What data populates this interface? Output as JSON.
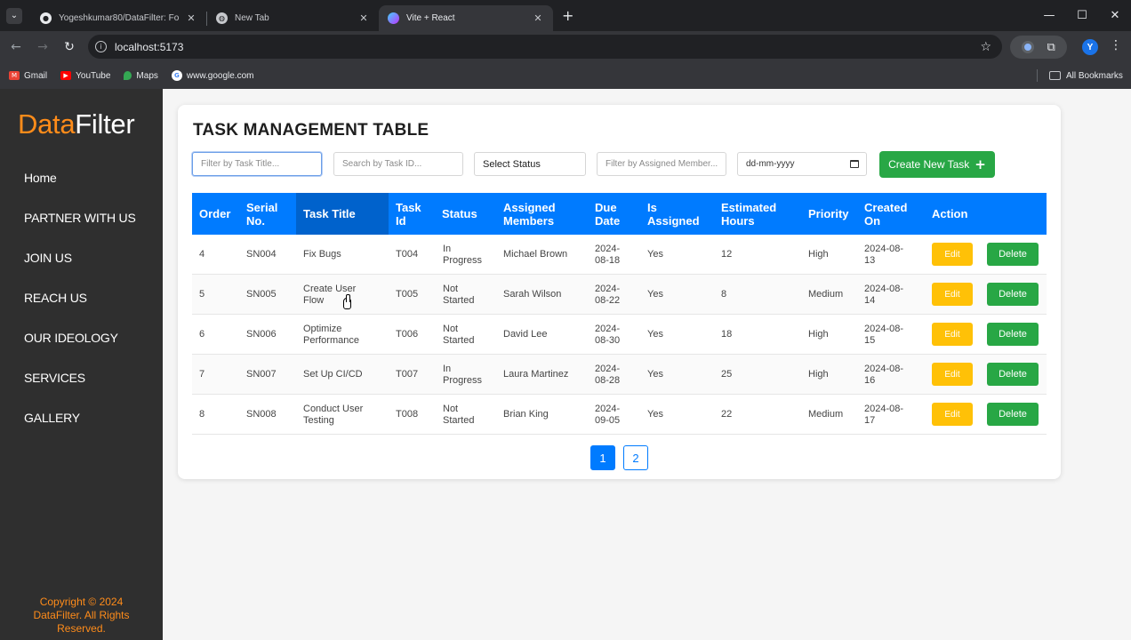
{
  "browser": {
    "tabs": [
      {
        "title": "Yogeshkumar80/DataFilter: Fo",
        "favicon": "github-icon",
        "active": false
      },
      {
        "title": "New Tab",
        "favicon": "chrome-globe-icon",
        "active": false
      },
      {
        "title": "Vite + React",
        "favicon": "vite-icon",
        "active": true
      }
    ],
    "url": "localhost:5173",
    "bookmarks": [
      "Gmail",
      "YouTube",
      "Maps",
      "www.google.com"
    ],
    "all_bookmarks": "All Bookmarks",
    "profile_initial": "Y"
  },
  "sidebar": {
    "brand_part1": "Data",
    "brand_part2": "Filter",
    "items": [
      "Home",
      "PARTNER WITH US",
      "JOIN US",
      "REACH US",
      "OUR IDEOLOGY",
      "SERVICES",
      "GALLERY"
    ],
    "copyright": "Copyright © 2024 DataFilter. All Rights Reserved."
  },
  "main": {
    "title": "TASK MANAGEMENT TABLE",
    "filters": {
      "task_title_placeholder": "Filter by Task Title...",
      "task_id_placeholder": "Search by Task ID...",
      "status_select": "Select Status",
      "member_placeholder": "Filter by Assigned Member...",
      "date_placeholder": "dd-mm-yyyy"
    },
    "create_button": "Create New Task",
    "columns": [
      {
        "key": "order",
        "label": "Order"
      },
      {
        "key": "serial",
        "label": "Serial No."
      },
      {
        "key": "title",
        "label": "Task Title"
      },
      {
        "key": "id",
        "label": "Task Id"
      },
      {
        "key": "status",
        "label": "Status"
      },
      {
        "key": "members",
        "label": "Assigned Members"
      },
      {
        "key": "due",
        "label": "Due Date"
      },
      {
        "key": "assigned",
        "label": "Is Assigned"
      },
      {
        "key": "hours",
        "label": "Estimated Hours"
      },
      {
        "key": "priority",
        "label": "Priority"
      },
      {
        "key": "created",
        "label": "Created On"
      },
      {
        "key": "action",
        "label": "Action"
      }
    ],
    "rows": [
      {
        "order": "4",
        "serial": "SN004",
        "title": "Fix Bugs",
        "id": "T004",
        "status": "In Progress",
        "members": "Michael Brown",
        "due": "2024-08-18",
        "assigned": "Yes",
        "hours": "12",
        "priority": "High",
        "created": "2024-08-13"
      },
      {
        "order": "5",
        "serial": "SN005",
        "title": "Create User Flow",
        "id": "T005",
        "status": "Not Started",
        "members": "Sarah Wilson",
        "due": "2024-08-22",
        "assigned": "Yes",
        "hours": "8",
        "priority": "Medium",
        "created": "2024-08-14"
      },
      {
        "order": "6",
        "serial": "SN006",
        "title": "Optimize Performance",
        "id": "T006",
        "status": "Not Started",
        "members": "David Lee",
        "due": "2024-08-30",
        "assigned": "Yes",
        "hours": "18",
        "priority": "High",
        "created": "2024-08-15"
      },
      {
        "order": "7",
        "serial": "SN007",
        "title": "Set Up CI/CD",
        "id": "T007",
        "status": "In Progress",
        "members": "Laura Martinez",
        "due": "2024-08-28",
        "assigned": "Yes",
        "hours": "25",
        "priority": "High",
        "created": "2024-08-16"
      },
      {
        "order": "8",
        "serial": "SN008",
        "title": "Conduct User Testing",
        "id": "T008",
        "status": "Not Started",
        "members": "Brian King",
        "due": "2024-09-05",
        "assigned": "Yes",
        "hours": "22",
        "priority": "Medium",
        "created": "2024-08-17"
      }
    ],
    "edit_label": "Edit",
    "delete_label": "Delete",
    "pages": [
      "1",
      "2"
    ],
    "current_page": "1"
  },
  "colors": {
    "accent_orange": "#ff8c1a",
    "header_blue": "#007bff",
    "sorted_header": "#0062cc",
    "success_green": "#28a745",
    "edit_yellow": "#ffc107",
    "sidebar_bg": "#2f2f2f"
  }
}
